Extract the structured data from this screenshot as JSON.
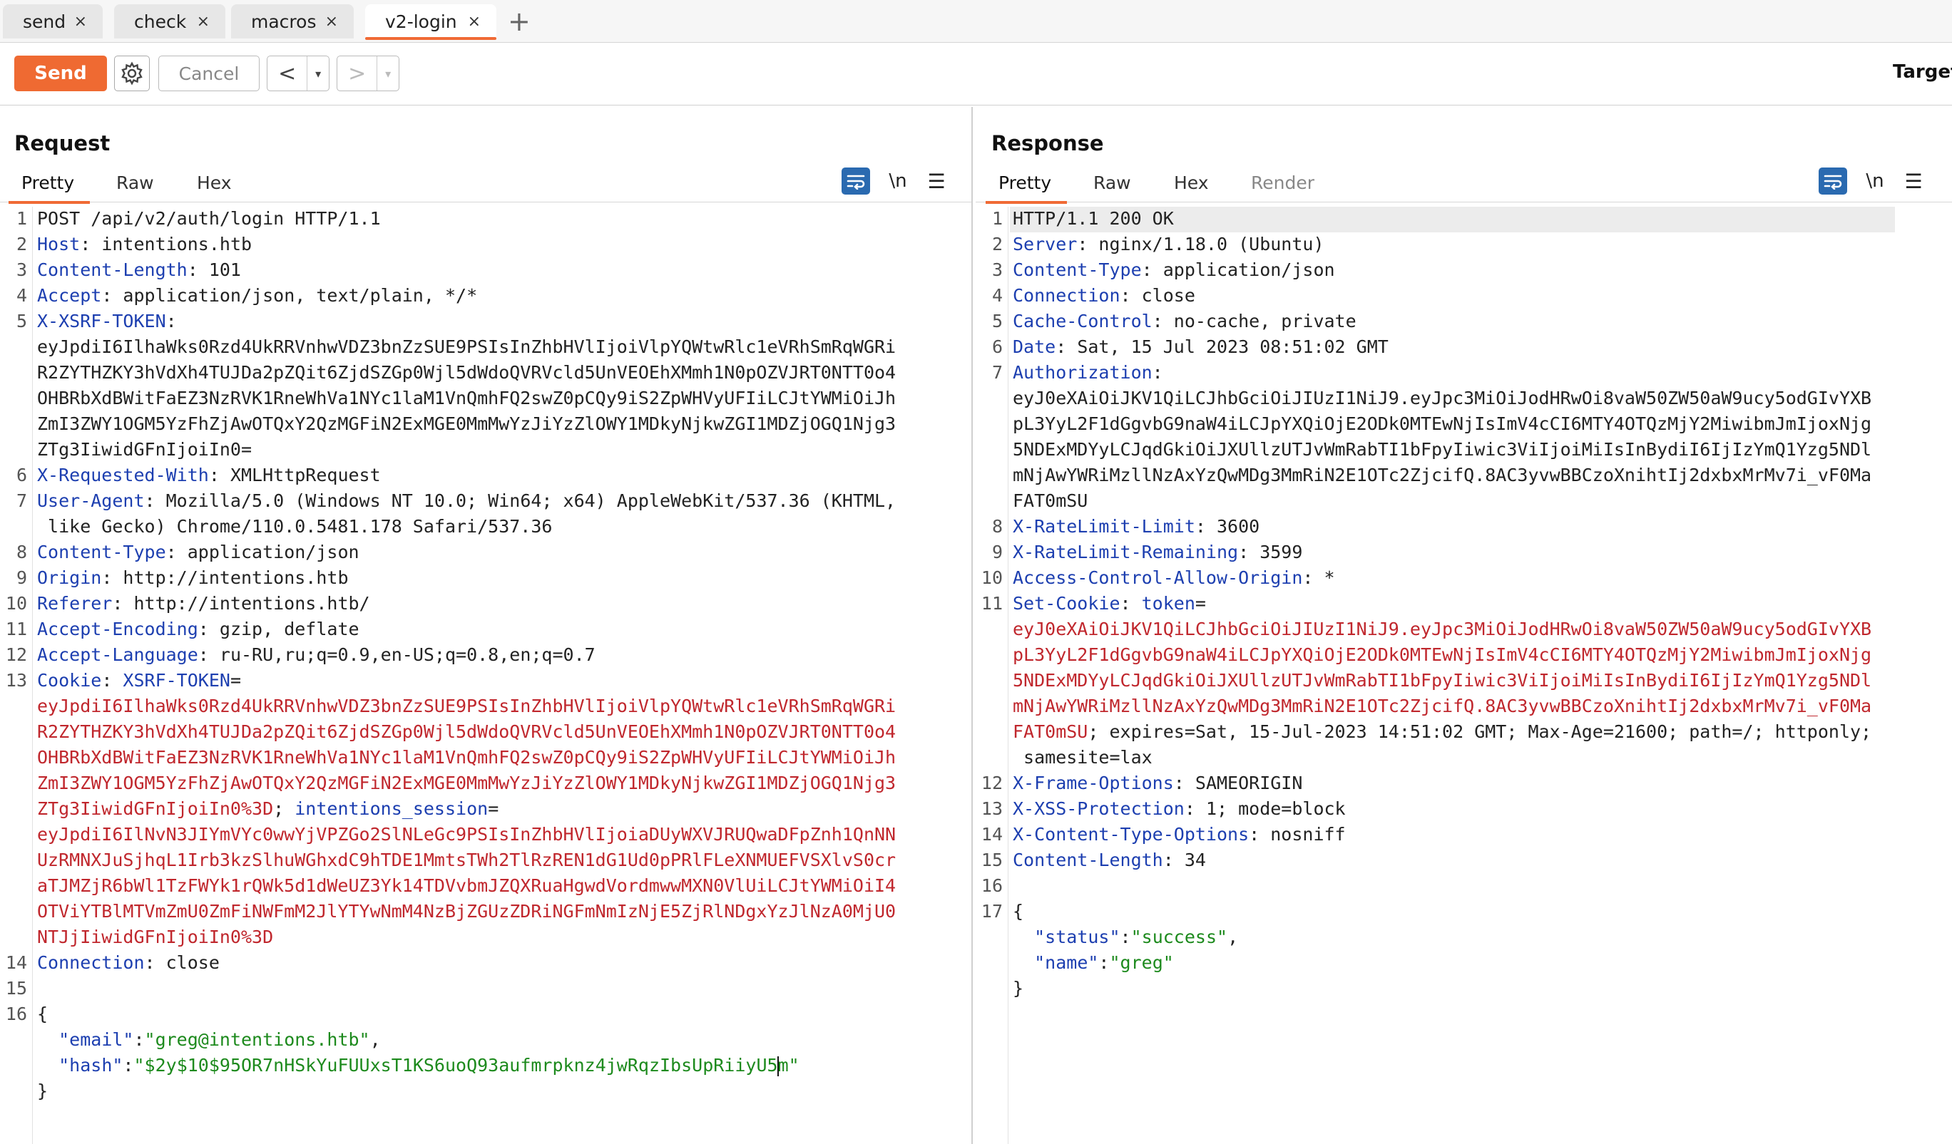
{
  "tabs": [
    {
      "label": "send",
      "close": "×"
    },
    {
      "label": "check",
      "close": "×"
    },
    {
      "label": "macros",
      "close": "×"
    },
    {
      "label": "v2-login",
      "close": "×"
    }
  ],
  "add_tab": "+",
  "toolbar": {
    "send_label": "Send",
    "cancel_label": "Cancel",
    "back_arrow": "<",
    "fwd_arrow": ">",
    "dropdown_glyph": "▾",
    "target_label": "Target"
  },
  "colors": {
    "accent": "#ef6a32",
    "active_blue": "#2a6ab0",
    "header_key": "#1d3fb0",
    "value_red": "#c0272d",
    "json_string": "#1d8a1d"
  },
  "icons": [
    "gear-icon",
    "word-wrap-icon",
    "newline-icon",
    "hamburger-menu-icon",
    "layout-side-by-side-icon",
    "layout-stacked-icon",
    "layout-single-icon"
  ],
  "request": {
    "title": "Request",
    "subtabs": [
      "Pretty",
      "Raw",
      "Hex"
    ],
    "newline_label": "\\n",
    "menu_glyph": "☰",
    "lines": {
      "l1": "POST /api/v2/auth/login HTTP/1.1",
      "l2": {
        "k": "Host",
        "v": "intentions.htb"
      },
      "l3": {
        "k": "Content-Length",
        "v": "101"
      },
      "l4": {
        "k": "Accept",
        "v": "application/json, text/plain, */*"
      },
      "l5": {
        "k": "X-XSRF-TOKEN",
        "w": [
          "eyJpdiI6IlhaWks0Rzd4UkRRVnhwVDZ3bnZzSUE9PSIsInZhbHVlIjoiVlpYQWtwRlc1eVRhSmRqWGRi",
          "R2ZYTHZKY3hVdXh4TUJDa2pZQit6ZjdSZGp0Wjl5dWdoQVRVcld5UnVEOEhXMmh1N0pOZVJRT0NTT0o4",
          "OHBRbXdBWitFaEZ3NzRVK1RneWhVa1NYc1laM1VnQmhFQ2swZ0pCQy9iS2ZpWHVyUFIiLCJtYWMiOiJh",
          "ZmI3ZWY1OGM5YzFhZjAwOTQxY2QzMGFiN2ExMGE0MmMwYzJiYzZlOWY1MDkyNjkwZGI1MDZjOGQ1Njg3",
          "ZTg3IiwidGFnIjoiIn0="
        ]
      },
      "l6": {
        "k": "X-Requested-With",
        "v": "XMLHttpRequest"
      },
      "l7": {
        "k": "User-Agent",
        "v": "Mozilla/5.0 (Windows NT 10.0; Win64; x64) AppleWebKit/537.36 (KHTML,",
        "v2": " like Gecko) Chrome/110.0.5481.178 Safari/537.36"
      },
      "l8": {
        "k": "Content-Type",
        "v": "application/json"
      },
      "l9": {
        "k": "Origin",
        "v": "http://intentions.htb"
      },
      "l10": {
        "k": "Referer",
        "v": "http://intentions.htb/"
      },
      "l11": {
        "k": "Accept-Encoding",
        "v": "gzip, deflate"
      },
      "l12": {
        "k": "Accept-Language",
        "v": "ru-RU,ru;q=0.9,en-US;q=0.8,en;q=0.7"
      },
      "l13": {
        "k": "Cookie",
        "ck1": "XSRF-TOKEN",
        "w1": [
          "eyJpdiI6IlhaWks0Rzd4UkRRVnhwVDZ3bnZzSUE9PSIsInZhbHVlIjoiVlpYQWtwRlc1eVRhSmRqWGRi",
          "R2ZYTHZKY3hVdXh4TUJDa2pZQit6ZjdSZGp0Wjl5dWdoQVRVcld5UnVEOEhXMmh1N0pOZVJRT0NTT0o4",
          "OHBRbXdBWitFaEZ3NzRVK1RneWhVa1NYc1laM1VnQmhFQ2swZ0pCQy9iS2ZpWHVyUFIiLCJtYWMiOiJh",
          "ZmI3ZWY1OGM5YzFhZjAwOTQxY2QzMGFiN2ExMGE0MmMwYzJiYzZlOWY1MDkyNjkwZGI1MDZjOGQ1Njg3",
          "ZTg3IiwidGFnIjoiIn0%3D"
        ],
        "ck2": "intentions_session",
        "w2": [
          "eyJpdiI6IlNvN3JIYmVYc0wwYjVPZGo2SlNLeGc9PSIsInZhbHVlIjoiaDUyWXVJRUQwaDFpZnh1QnNN",
          "UzRMNXJuSjhqL1Irb3kzSlhuWGhxdC9hTDE1MmtsTWh2TlRzREN1dG1Ud0pPRlFLeXNMUEFVSXlvS0cr",
          "aTJMZjR6bWl1TzFWYk1rQWk5d1dWeUZ3Yk14TDVvbmJZQXRuaHgwdVordmwwMXN0VlUiLCJtYWMiOiI4",
          "OTViYTBlMTVmZmU0ZmFiNWFmM2JlYTYwNmM4NzBjZGUzZDRiNGFmNmIzNjE5ZjRlNDgxYzJlNzA0MjU0",
          "NTJjIiwidGFnIjoiIn0%3D"
        ]
      },
      "l14": {
        "k": "Connection",
        "v": "close"
      },
      "body_email_key": "\"email\"",
      "body_email_val": "\"greg@intentions.htb\"",
      "body_hash_key": "\"hash\"",
      "body_hash_val_a": "\"$2y$10$95OR7nHSkYuFUUxsT1KS6uoQ93aufmrpknz4jwRqzIbsUpRiiyU5",
      "body_hash_val_b": "m\""
    }
  },
  "response": {
    "title": "Response",
    "subtabs": [
      "Pretty",
      "Raw",
      "Hex",
      "Render"
    ],
    "newline_label": "\\n",
    "menu_glyph": "☰",
    "lines": {
      "l1": "HTTP/1.1 200 OK",
      "l2": {
        "k": "Server",
        "v": "nginx/1.18.0 (Ubuntu)"
      },
      "l3": {
        "k": "Content-Type",
        "v": "application/json"
      },
      "l4": {
        "k": "Connection",
        "v": "close"
      },
      "l5": {
        "k": "Cache-Control",
        "v": "no-cache, private"
      },
      "l6": {
        "k": "Date",
        "v": "Sat, 15 Jul 2023 08:51:02 GMT"
      },
      "l7": {
        "k": "Authorization",
        "w": [
          "eyJ0eXAiOiJKV1QiLCJhbGciOiJIUzI1NiJ9.eyJpc3MiOiJodHRwOi8vaW50ZW50aW9ucy5odGIvYXB",
          "pL3YyL2F1dGgvbG9naW4iLCJpYXQiOjE2ODk0MTEwNjIsImV4cCI6MTY4OTQzMjY2MiwibmJmIjoxNjg",
          "5NDExMDYyLCJqdGkiOiJXUllzUTJvWmRabTI1bFpyIiwic3ViIjoiMiIsInBydiI6IjIzYmQ1Yzg5NDl",
          "mNjAwYWRiMzllNzAxYzQwMDg3MmRiN2E1OTc2ZjcifQ.8AC3yvwBBCzoXnihtIj2dxbxMrMv7i_vF0Ma",
          "FAT0mSU"
        ]
      },
      "l8": {
        "k": "X-RateLimit-Limit",
        "v": "3600"
      },
      "l9": {
        "k": "X-RateLimit-Remaining",
        "v": "3599"
      },
      "l10": {
        "k": "Access-Control-Allow-Origin",
        "v": "*"
      },
      "l11": {
        "k": "Set-Cookie",
        "ck": "token",
        "w": [
          "eyJ0eXAiOiJKV1QiLCJhbGciOiJIUzI1NiJ9.eyJpc3MiOiJodHRwOi8vaW50ZW50aW9ucy5odGIvYXB",
          "pL3YyL2F1dGgvbG9naW4iLCJpYXQiOjE2ODk0MTEwNjIsImV4cCI6MTY4OTQzMjY2MiwibmJmIjoxNjg",
          "5NDExMDYyLCJqdGkiOiJXUllzUTJvWmRabTI1bFpyIiwic3ViIjoiMiIsInBydiI6IjIzYmQ1Yzg5NDl",
          "mNjAwYWRiMzllNzAxYzQwMDg3MmRiN2E1OTc2ZjcifQ.8AC3yvwBBCzoXnihtIj2dxbxMrMv7i_vF0Ma"
        ],
        "tail_red": "FAT0mSU",
        "tail_rest": "; expires=Sat, 15-Jul-2023 14:51:02 GMT; Max-Age=21600; path=/; httponly;",
        "tail2": " samesite=lax"
      },
      "l12": {
        "k": "X-Frame-Options",
        "v": "SAMEORIGIN"
      },
      "l13": {
        "k": "X-XSS-Protection",
        "v": "1; mode=block"
      },
      "l14": {
        "k": "X-Content-Type-Options",
        "v": "nosniff"
      },
      "l15": {
        "k": "Content-Length",
        "v": "34"
      },
      "body_status_key": "\"status\"",
      "body_status_val": "\"success\"",
      "body_name_key": "\"name\"",
      "body_name_val": "\"greg\""
    }
  }
}
